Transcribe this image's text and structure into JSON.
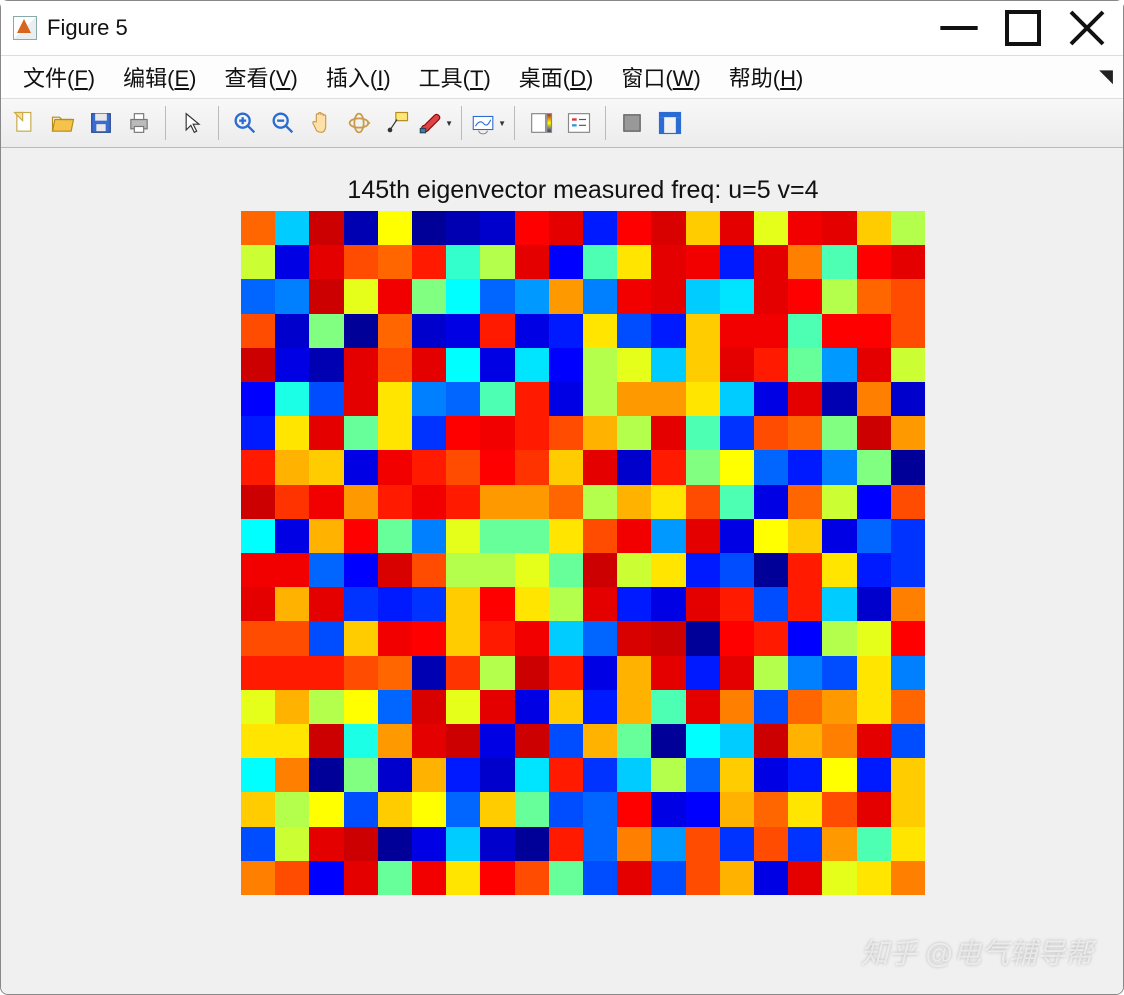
{
  "window": {
    "title": "Figure 5"
  },
  "menu": {
    "file": {
      "label": "文件",
      "accel": "F"
    },
    "edit": {
      "label": "编辑",
      "accel": "E"
    },
    "view": {
      "label": "查看",
      "accel": "V"
    },
    "insert": {
      "label": "插入",
      "accel": "I"
    },
    "tools": {
      "label": "工具",
      "accel": "T"
    },
    "desktop": {
      "label": "桌面",
      "accel": "D"
    },
    "window": {
      "label": "窗口",
      "accel": "W"
    },
    "help": {
      "label": "帮助",
      "accel": "H"
    }
  },
  "toolbar": {
    "icons": [
      "new-figure-icon",
      "open-icon",
      "save-icon",
      "print-icon",
      "SEP",
      "pointer-icon",
      "SEP",
      "zoom-in-icon",
      "zoom-out-icon",
      "pan-icon",
      "rotate-3d-icon",
      "data-cursor-icon",
      "brush-icon",
      "SEP",
      "link-plot-icon",
      "SEP",
      "colorbar-icon",
      "legend-icon",
      "SEP",
      "hide-plot-tools-icon",
      "show-plot-tools-icon"
    ]
  },
  "chart_data": {
    "type": "heatmap",
    "title": "145th eigenvector measured freq: u=5 v=4",
    "rows": 20,
    "cols": 20,
    "colormap": "jet",
    "value_range": [
      -1,
      1
    ],
    "values": [
      [
        0.55,
        -0.35,
        0.95,
        -0.9,
        0.25,
        -0.95,
        -0.9,
        -0.85,
        0.75,
        0.85,
        -0.7,
        0.75,
        0.9,
        0.35,
        0.85,
        0.2,
        0.8,
        0.85,
        0.35,
        0.1
      ],
      [
        0.15,
        -0.8,
        0.85,
        0.6,
        0.55,
        0.7,
        -0.15,
        0.1,
        0.85,
        -0.75,
        -0.1,
        0.3,
        0.85,
        0.8,
        -0.7,
        0.85,
        0.5,
        -0.1,
        0.75,
        0.85
      ],
      [
        -0.55,
        -0.5,
        0.95,
        0.2,
        0.8,
        0.0,
        -0.25,
        -0.55,
        -0.45,
        0.45,
        -0.5,
        0.8,
        0.85,
        -0.35,
        -0.3,
        0.85,
        0.75,
        0.1,
        0.55,
        0.6
      ],
      [
        0.6,
        -0.85,
        0.0,
        -0.95,
        0.55,
        -0.85,
        -0.8,
        0.7,
        -0.8,
        -0.7,
        0.3,
        -0.6,
        -0.7,
        0.35,
        0.8,
        0.8,
        -0.1,
        0.75,
        0.75,
        0.6
      ],
      [
        0.95,
        -0.8,
        -0.9,
        0.85,
        0.6,
        0.85,
        -0.25,
        -0.8,
        -0.3,
        -0.75,
        0.1,
        0.2,
        -0.35,
        0.35,
        0.85,
        0.7,
        -0.05,
        -0.45,
        0.85,
        0.15
      ],
      [
        -0.75,
        -0.2,
        -0.6,
        0.85,
        0.3,
        -0.5,
        -0.55,
        -0.1,
        0.7,
        -0.8,
        0.1,
        0.45,
        0.45,
        0.3,
        -0.35,
        -0.8,
        0.85,
        -0.9,
        0.5,
        -0.85
      ],
      [
        -0.7,
        0.3,
        0.85,
        -0.05,
        0.3,
        -0.65,
        0.75,
        0.8,
        0.7,
        0.6,
        0.4,
        0.1,
        0.85,
        -0.1,
        -0.65,
        0.6,
        0.55,
        0.0,
        0.95,
        0.45
      ],
      [
        0.7,
        0.4,
        0.35,
        -0.8,
        0.8,
        0.7,
        0.6,
        0.75,
        0.65,
        0.35,
        0.85,
        -0.85,
        0.7,
        0.0,
        0.25,
        -0.55,
        -0.7,
        -0.5,
        0.0,
        -0.95
      ],
      [
        0.95,
        0.65,
        0.8,
        0.45,
        0.7,
        0.8,
        0.7,
        0.45,
        0.45,
        0.55,
        0.1,
        0.4,
        0.3,
        0.6,
        -0.1,
        -0.8,
        0.55,
        0.15,
        -0.75,
        0.6
      ],
      [
        -0.25,
        -0.8,
        0.4,
        0.75,
        -0.05,
        -0.5,
        0.2,
        -0.05,
        -0.05,
        0.3,
        0.6,
        0.8,
        -0.45,
        0.85,
        -0.8,
        0.25,
        0.35,
        -0.8,
        -0.55,
        -0.65
      ],
      [
        0.8,
        0.8,
        -0.55,
        -0.75,
        0.9,
        0.6,
        0.1,
        0.1,
        0.2,
        -0.05,
        0.95,
        0.15,
        0.3,
        -0.7,
        -0.6,
        -0.95,
        0.7,
        0.3,
        -0.7,
        -0.65
      ],
      [
        0.85,
        0.4,
        0.85,
        -0.65,
        -0.7,
        -0.65,
        0.35,
        0.75,
        0.3,
        0.1,
        0.85,
        -0.7,
        -0.8,
        0.85,
        0.7,
        -0.6,
        0.7,
        -0.35,
        -0.85,
        0.5
      ],
      [
        0.6,
        0.6,
        -0.6,
        0.35,
        0.8,
        0.75,
        0.35,
        0.7,
        0.8,
        -0.35,
        -0.55,
        0.9,
        0.95,
        -0.95,
        0.75,
        0.7,
        -0.75,
        0.1,
        0.2,
        0.75
      ],
      [
        0.7,
        0.7,
        0.7,
        0.6,
        0.55,
        -0.9,
        0.65,
        0.1,
        0.95,
        0.7,
        -0.8,
        0.4,
        0.85,
        -0.7,
        0.85,
        0.1,
        -0.5,
        -0.6,
        0.3,
        -0.5
      ],
      [
        0.2,
        0.4,
        0.1,
        0.25,
        -0.55,
        0.9,
        0.2,
        0.85,
        -0.8,
        0.35,
        -0.7,
        0.4,
        -0.1,
        0.85,
        0.5,
        -0.6,
        0.55,
        0.45,
        0.3,
        0.55
      ],
      [
        0.3,
        0.3,
        0.95,
        -0.2,
        0.45,
        0.85,
        0.95,
        -0.8,
        0.95,
        -0.6,
        0.4,
        -0.05,
        -0.95,
        -0.25,
        -0.35,
        0.95,
        0.4,
        0.5,
        0.85,
        -0.6
      ],
      [
        -0.25,
        0.5,
        -0.95,
        0.0,
        -0.85,
        0.4,
        -0.7,
        -0.85,
        -0.3,
        0.7,
        -0.65,
        -0.35,
        0.1,
        -0.55,
        0.35,
        -0.8,
        -0.7,
        0.25,
        -0.7,
        0.35
      ],
      [
        0.35,
        0.1,
        0.25,
        -0.6,
        0.35,
        0.25,
        -0.55,
        0.35,
        -0.05,
        -0.6,
        -0.55,
        0.75,
        -0.8,
        -0.75,
        0.4,
        0.55,
        0.3,
        0.6,
        0.85,
        0.35
      ],
      [
        -0.6,
        0.15,
        0.85,
        0.95,
        -0.95,
        -0.8,
        -0.35,
        -0.85,
        -0.95,
        0.7,
        -0.55,
        0.5,
        -0.45,
        0.6,
        -0.65,
        0.6,
        -0.65,
        0.45,
        -0.1,
        0.3
      ],
      [
        0.5,
        0.6,
        -0.75,
        0.85,
        -0.05,
        0.8,
        0.3,
        0.75,
        0.6,
        -0.05,
        -0.6,
        0.85,
        -0.6,
        0.6,
        0.4,
        -0.8,
        0.85,
        0.2,
        0.3,
        0.5
      ]
    ]
  },
  "watermark": "知乎 @电气辅导帮"
}
